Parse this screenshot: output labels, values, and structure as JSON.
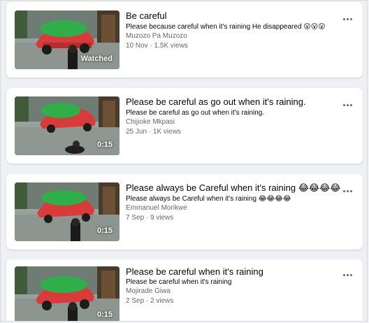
{
  "items": [
    {
      "title": "Be careful",
      "description": "Please because careful when it's raining He disappeared 😮😮😮",
      "author": "Muzozo Pa Muzozo",
      "meta": "10 Nov · 1.5K views",
      "badge": "Watched"
    },
    {
      "title": "Please be careful as go out when it's raining.",
      "description": "Please be careful as go out when it's raining.",
      "author": "Chijioke Mkpasi",
      "meta": "25 Jun · 1K views",
      "badge": "0:15"
    },
    {
      "title": "Please always be Careful when it's raining 😂😂😂😂",
      "description": "Please always be Careful when it's raining 😂😂😂😂",
      "author": "Emmanuel Morikwe",
      "meta": "7 Sep · 9 views",
      "badge": "0:15"
    },
    {
      "title": "Please be careful when it's raining",
      "description": "Please be careful when it's raining",
      "author": "Mojirade Giwa",
      "meta": "2 Sep · 2 views",
      "badge": "0:15"
    }
  ]
}
